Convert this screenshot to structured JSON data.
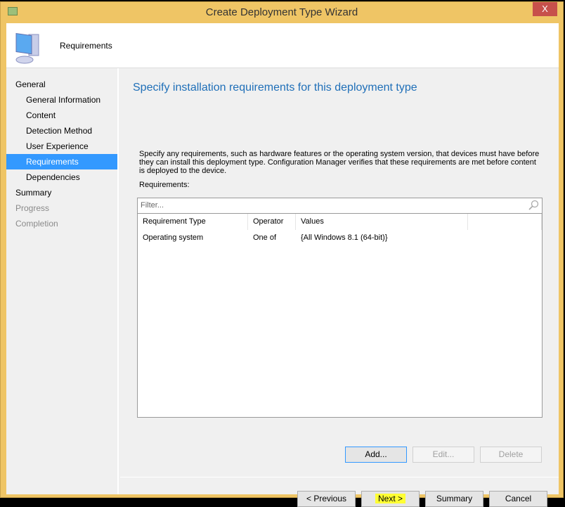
{
  "window": {
    "title": "Create Deployment Type Wizard",
    "close": "X"
  },
  "header": {
    "title": "Requirements"
  },
  "nav": [
    {
      "label": "General",
      "level": 0,
      "state": "normal"
    },
    {
      "label": "General Information",
      "level": 1,
      "state": "normal"
    },
    {
      "label": "Content",
      "level": 1,
      "state": "normal"
    },
    {
      "label": "Detection Method",
      "level": 1,
      "state": "normal"
    },
    {
      "label": "User Experience",
      "level": 1,
      "state": "normal"
    },
    {
      "label": "Requirements",
      "level": 1,
      "state": "selected"
    },
    {
      "label": "Dependencies",
      "level": 1,
      "state": "normal"
    },
    {
      "label": "Summary",
      "level": 0,
      "state": "normal"
    },
    {
      "label": "Progress",
      "level": 0,
      "state": "disabled"
    },
    {
      "label": "Completion",
      "level": 0,
      "state": "disabled"
    }
  ],
  "main": {
    "heading": "Specify installation requirements for this deployment type",
    "description": "Specify any requirements, such as hardware features or the operating system version, that devices must have before they can install this deployment type. Configuration Manager verifies that these requirements are met before content is deployed to the device.",
    "requirements_label": "Requirements:",
    "filter_placeholder": "Filter...",
    "columns": [
      "Requirement Type",
      "Operator",
      "Values"
    ],
    "rows": [
      [
        "Operating system",
        "One of",
        "{All Windows 8.1 (64-bit)}"
      ]
    ],
    "add": "Add...",
    "edit": "Edit...",
    "delete": "Delete"
  },
  "footer": {
    "previous": "< Previous",
    "next": "Next >",
    "summary": "Summary",
    "cancel": "Cancel"
  },
  "colors": {
    "accent": "#3399ff",
    "heading": "#1f6fb8",
    "frame": "#efc565",
    "highlight": "#ffff33"
  }
}
